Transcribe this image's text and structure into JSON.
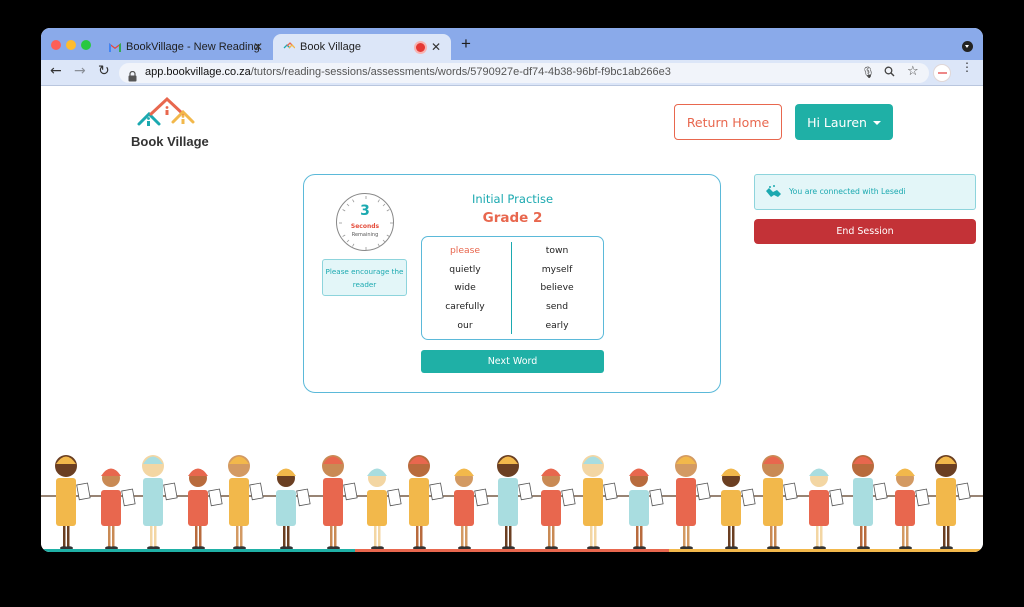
{
  "browser": {
    "tabs": [
      {
        "title": "BookVillage - New Reading Se",
        "icon": "gmail-icon"
      },
      {
        "title": "Book Village",
        "icon": "bookvillage-icon",
        "recording": true
      }
    ],
    "new_tab": "+",
    "url_host": "app.bookvillage.co.za",
    "url_path": "/tutors/reading-sessions/assessments/words/5790927e-df74-4b38-96bf-f9bc1ab266e3"
  },
  "header": {
    "logo_text": "Book Village",
    "return_home": "Return Home",
    "user_menu": "Hi Lauren"
  },
  "assessment": {
    "timer": {
      "value": "3",
      "unit": "Seconds",
      "label": "Remaining"
    },
    "encourage": "Please encourage the reader",
    "title": "Initial Practise",
    "grade": "Grade 2",
    "words_left": [
      "please",
      "quietly",
      "wide",
      "carefully",
      "our"
    ],
    "words_right": [
      "town",
      "myself",
      "believe",
      "send",
      "early"
    ],
    "active_word": "please",
    "next_button": "Next Word"
  },
  "session": {
    "connected_text": "You are connected with Lesedi",
    "end_button": "End Session"
  },
  "colors": {
    "teal": "#1fb0a6",
    "coral": "#e8674e",
    "red": "#c33237",
    "outline_blue": "#5bb9d9"
  }
}
